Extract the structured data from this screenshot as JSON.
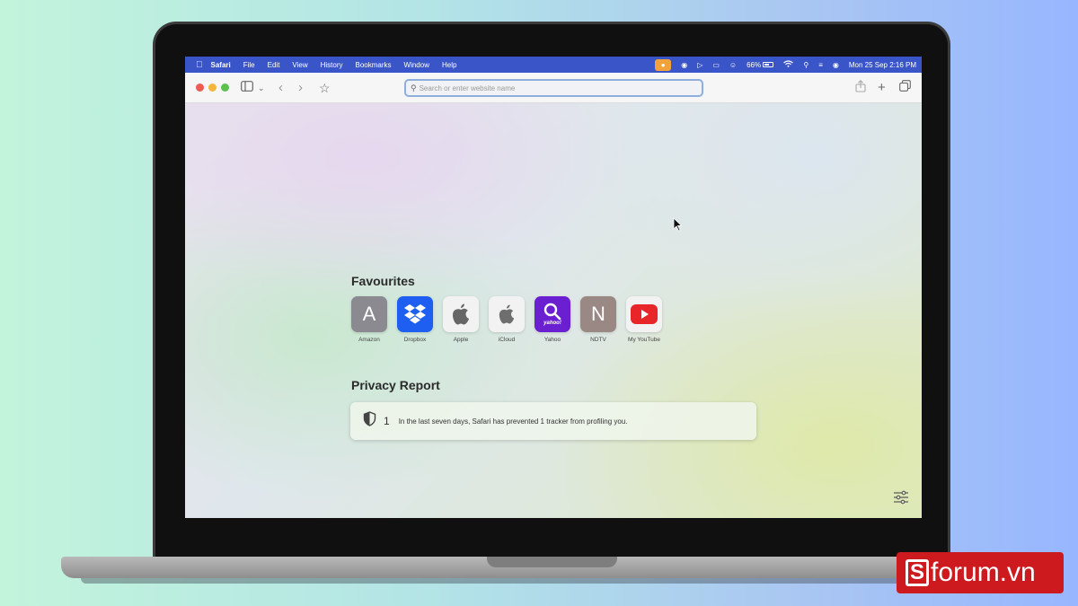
{
  "menubar": {
    "app": "Safari",
    "items": [
      "File",
      "Edit",
      "View",
      "History",
      "Bookmarks",
      "Window",
      "Help"
    ],
    "battery": "66%",
    "datetime": "Mon 25 Sep  2:16 PM"
  },
  "toolbar": {
    "address_placeholder": "Search or enter website name"
  },
  "favourites": {
    "title": "Favourites",
    "items": [
      {
        "label": "Amazon",
        "icon": "letter-a",
        "letter": "A",
        "bg": "#8a8a90"
      },
      {
        "label": "Dropbox",
        "icon": "dropbox-icon",
        "bg": "#1e5ff2"
      },
      {
        "label": "Apple",
        "icon": "apple-icon",
        "bg": "#f2f2f2"
      },
      {
        "label": "iCloud",
        "icon": "apple-icon",
        "bg": "#f2f2f2"
      },
      {
        "label": "Yahoo",
        "icon": "yahoo-search-icon",
        "sub": "yahoo!",
        "bg": "#6a1fd1"
      },
      {
        "label": "NDTV",
        "icon": "letter-n",
        "letter": "N",
        "bg": "#9a8884"
      },
      {
        "label": "My YouTube",
        "icon": "youtube-icon",
        "bg": "#f2f2f2"
      }
    ]
  },
  "privacy": {
    "title": "Privacy Report",
    "count": "1",
    "message": "In the last seven days, Safari has prevented 1 tracker from profiling you."
  },
  "watermark": {
    "text": "forum.vn",
    "s": "S"
  },
  "colors": {
    "menubar": "#3a55c7",
    "brand": "#cc1a1f"
  }
}
